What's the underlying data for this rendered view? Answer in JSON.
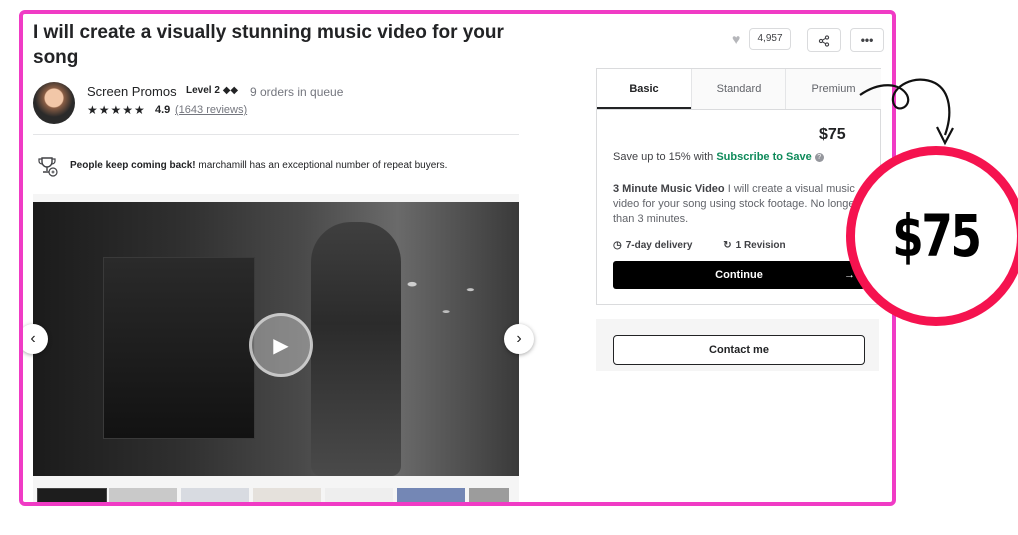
{
  "gig": {
    "title": "I will create a visually stunning music video for your song"
  },
  "seller": {
    "name": "Screen Promos",
    "level": "Level 2",
    "level_icons": "◆◆",
    "queue": "9 orders in queue",
    "stars": "★★★★★",
    "rating": "4.9",
    "reviews": "(1643 reviews)"
  },
  "repeat_buyers": {
    "bold": "People keep coming back!",
    "text": " marchamill has an exceptional number of repeat buyers."
  },
  "actions": {
    "like_count": "4,957",
    "share_icon": "share-icon",
    "more_label": "•••"
  },
  "packages": {
    "tabs": [
      {
        "label": "Basic",
        "active": true
      },
      {
        "label": "Standard",
        "active": false
      },
      {
        "label": "Premium",
        "active": false
      }
    ],
    "price": "$75",
    "save_prefix": "Save up to 15% with ",
    "save_link": "Subscribe to Save",
    "desc_title": "3 Minute Music Video",
    "desc_text": " I will create a visual music video for your song using stock footage. No longer than 3 minutes.",
    "delivery": "7-day delivery",
    "revisions": "1 Revision",
    "continue_label": "Continue",
    "continue_arrow": "→"
  },
  "contact": {
    "label": "Contact me"
  },
  "callout": {
    "price": "$75"
  },
  "colors": {
    "frame_border": "#f03bc5",
    "callout_ring": "#f5134f",
    "subscribe_link": "#0e8a5a"
  }
}
